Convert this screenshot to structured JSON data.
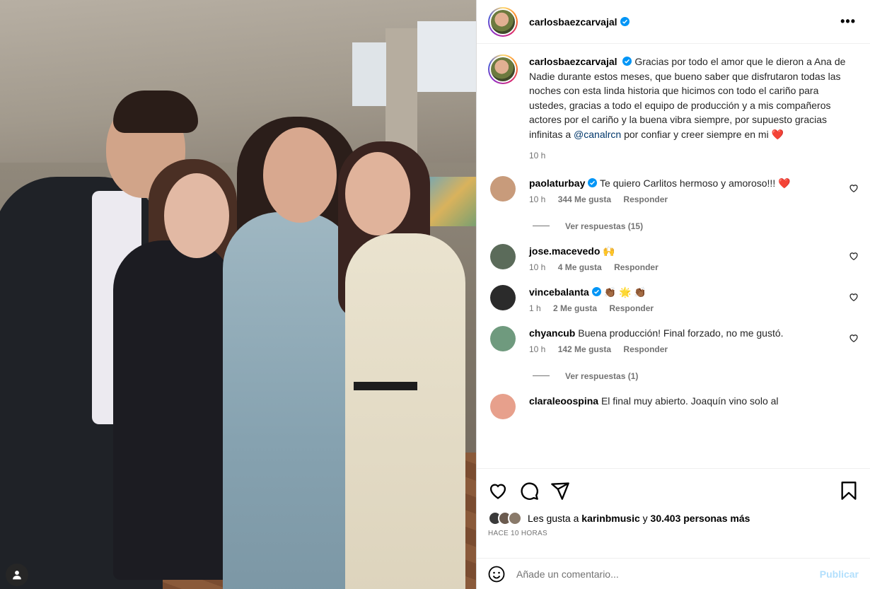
{
  "post": {
    "username": "carlosbaezcarvajal",
    "more_label": "•••",
    "caption_user": "carlosbaezcarvajal",
    "caption_text": "Gracias por todo el amor que le dieron a Ana de Nadie durante estos meses, que bueno saber que disfrutaron todas las noches con esta linda historia que hicimos con todo el cariño para ustedes, gracias a todo el equipo de producción y a mis compañeros actores por el cariño y la buena vibra siempre, por supuesto gracias infinitas a",
    "caption_mention": "@canalrcn",
    "caption_tail": "por confiar y creer siempre en mi",
    "caption_emoji": "❤️",
    "caption_time": "10 h"
  },
  "comments": [
    {
      "user": "paolaturbay",
      "verified": true,
      "text": "Te quiero Carlitos hermoso y amoroso!!! ❤️",
      "time": "10 h",
      "likes": "344 Me gusta",
      "reply": "Responder",
      "replies": "Ver respuestas (15)",
      "avatar_color": "#c89b7b"
    },
    {
      "user": "jose.macevedo",
      "verified": false,
      "text": "🙌",
      "time": "10 h",
      "likes": "4 Me gusta",
      "reply": "Responder",
      "replies": "",
      "avatar_color": "#5b6b5a"
    },
    {
      "user": "vincebalanta",
      "verified": true,
      "text": "👏🏾 🌟 👏🏾",
      "time": "1 h",
      "likes": "2 Me gusta",
      "reply": "Responder",
      "replies": "",
      "avatar_color": "#2b2b2b"
    },
    {
      "user": "chyancub",
      "verified": false,
      "text": "Buena producción! Final forzado, no me gustó.",
      "time": "10 h",
      "likes": "142 Me gusta",
      "reply": "Responder",
      "replies": "Ver respuestas (1)",
      "avatar_color": "#6f9a7e"
    },
    {
      "user": "claraleoospina",
      "verified": false,
      "text": "El final muy abierto. Joaquín vino solo al",
      "time": "",
      "likes": "",
      "reply": "",
      "replies": "",
      "avatar_color": "#e7a08c"
    }
  ],
  "likes": {
    "prefix": "Les gusta a",
    "user": "karinbmusic",
    "connector": "y",
    "others": "30.403 personas más"
  },
  "posted_ago": "HACE 10 HORAS",
  "add_comment": {
    "placeholder": "Añade un comentario...",
    "publish": "Publicar"
  },
  "colors": {
    "verified_blue": "#0095f6",
    "link_blue": "#00376b",
    "heart_red": "#ed4956",
    "publish_disabled": "#b2dffc"
  },
  "icons": [
    "heart-icon",
    "comment-icon",
    "share-icon",
    "bookmark-icon",
    "emoji-icon",
    "user-tag-icon",
    "more-icon",
    "verified-icon"
  ]
}
